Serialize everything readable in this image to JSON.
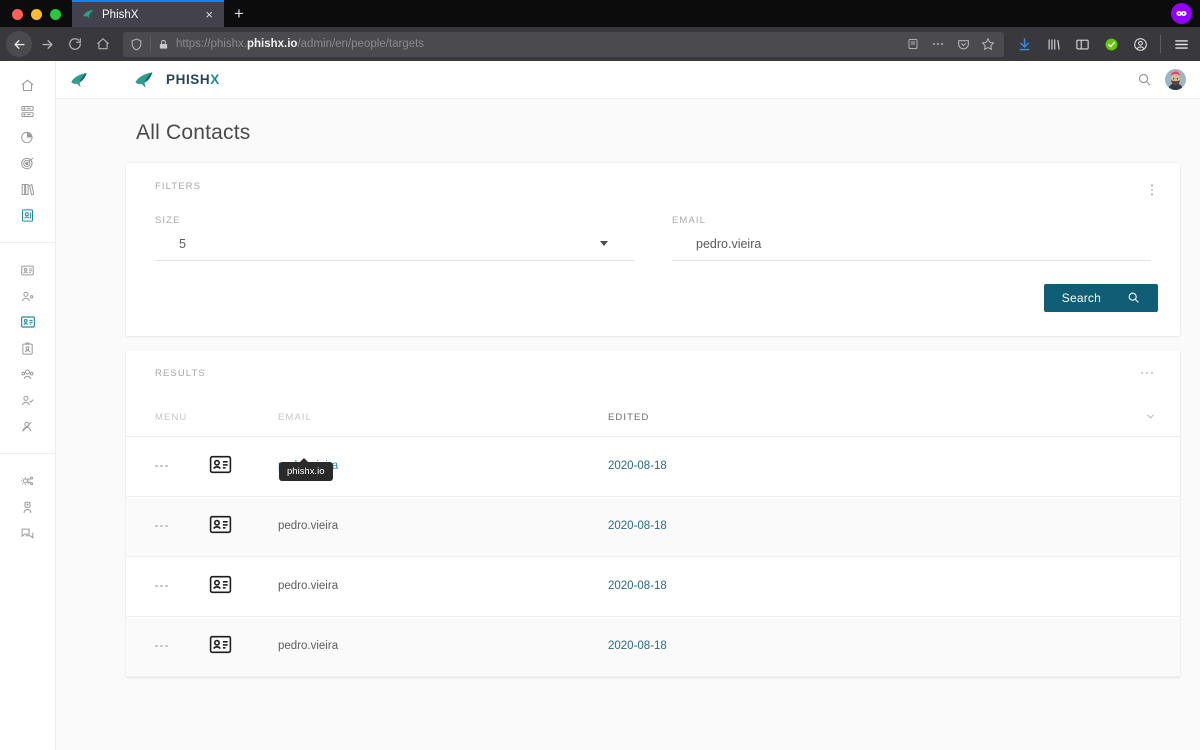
{
  "browser": {
    "tab": {
      "title": "PhishX",
      "favicon": "phishx-fish-icon",
      "close_label": "×"
    },
    "new_tab_label": "+",
    "url": {
      "prefix": "https://phishx.",
      "domain": "phishx.io",
      "path": "/admin/en/people/targets"
    },
    "nav": {
      "back": "back-arrow",
      "forward": "forward-arrow",
      "reload": "↻",
      "home": "⌂"
    },
    "toolbar_icons": [
      "reader-view-icon",
      "page-actions-icon",
      "pocket-icon",
      "bookmark-star-icon",
      "downloads-icon",
      "library-icon",
      "sidebar-icon",
      "sync-ok-icon",
      "account-icon",
      "app-menu-icon"
    ],
    "pocket_badge": "pocket-badge-icon"
  },
  "app": {
    "brand": {
      "name_main": "PHISH",
      "name_accent": "X",
      "logo": "phishx-fish-logo"
    },
    "topbar": {
      "search_icon": "search-icon",
      "avatar": "user-avatar"
    },
    "sidebar": {
      "groups": [
        {
          "items": [
            {
              "name": "home",
              "icon": "home-icon",
              "active": false
            },
            {
              "name": "servers",
              "icon": "server-rack-icon",
              "active": false
            },
            {
              "name": "reports",
              "icon": "pie-chart-icon",
              "active": false
            },
            {
              "name": "campaigns",
              "icon": "target-icon",
              "active": false
            },
            {
              "name": "library",
              "icon": "books-icon",
              "active": false
            },
            {
              "name": "contacts",
              "icon": "address-book-icon",
              "active": true
            }
          ]
        },
        {
          "items": [
            {
              "name": "all-contacts",
              "icon": "contact-card-icon",
              "active": false
            },
            {
              "name": "add-person",
              "icon": "person-add-icon",
              "active": false
            },
            {
              "name": "targets",
              "icon": "contact-card-filled-icon",
              "active": true
            },
            {
              "name": "id-badge",
              "icon": "id-badge-icon",
              "active": false
            },
            {
              "name": "groups",
              "icon": "people-group-icon",
              "active": false
            },
            {
              "name": "verified-user",
              "icon": "person-check-icon",
              "active": false
            },
            {
              "name": "blocked-user",
              "icon": "person-blocked-icon",
              "active": false
            }
          ]
        },
        {
          "items": [
            {
              "name": "settings",
              "icon": "gear-network-icon",
              "active": false
            },
            {
              "name": "profile",
              "icon": "user-badge-icon",
              "active": false
            },
            {
              "name": "messages",
              "icon": "chat-bubbles-icon",
              "active": false
            }
          ]
        }
      ]
    },
    "page": {
      "title": "All Contacts"
    },
    "filters": {
      "label": "FILTERS",
      "menu_icon": "kebab-menu-icon",
      "size": {
        "label": "SIZE",
        "value": "5",
        "caret_icon": "caret-down-icon"
      },
      "email": {
        "label": "EMAIL",
        "value": "pedro.vieira",
        "placeholder": ""
      },
      "search_button": {
        "label": "Search",
        "icon": "search-icon"
      }
    },
    "results": {
      "label": "RESULTS",
      "menu_icon": "ellipsis-menu-icon",
      "columns": {
        "menu": "MENU",
        "icon": "",
        "email": "EMAIL",
        "edited": "EDITED",
        "sort_icon": "chevron-down-icon"
      },
      "rows": [
        {
          "menu": "row-menu-icon",
          "icon": "contact-card-icon",
          "email": "pedro.vieira",
          "edited": "2020-08-18",
          "hovered": true,
          "tooltip": "phishx.io"
        },
        {
          "menu": "row-menu-icon",
          "icon": "contact-card-icon",
          "email": "pedro.vieira",
          "edited": "2020-08-18",
          "hovered": false,
          "tooltip": ""
        },
        {
          "menu": "row-menu-icon",
          "icon": "contact-card-icon",
          "email": "pedro.vieira",
          "edited": "2020-08-18",
          "hovered": false,
          "tooltip": ""
        },
        {
          "menu": "row-menu-icon",
          "icon": "contact-card-icon",
          "email": "pedro.vieira",
          "edited": "2020-08-18",
          "hovered": false,
          "tooltip": ""
        }
      ]
    },
    "colors": {
      "accent_teal": "#1f8a9e",
      "button_blue": "#0f5e76",
      "link_blue": "#2b6a83",
      "tooltip_bg": "#2a2a2a",
      "page_bg": "#fafafa"
    }
  }
}
